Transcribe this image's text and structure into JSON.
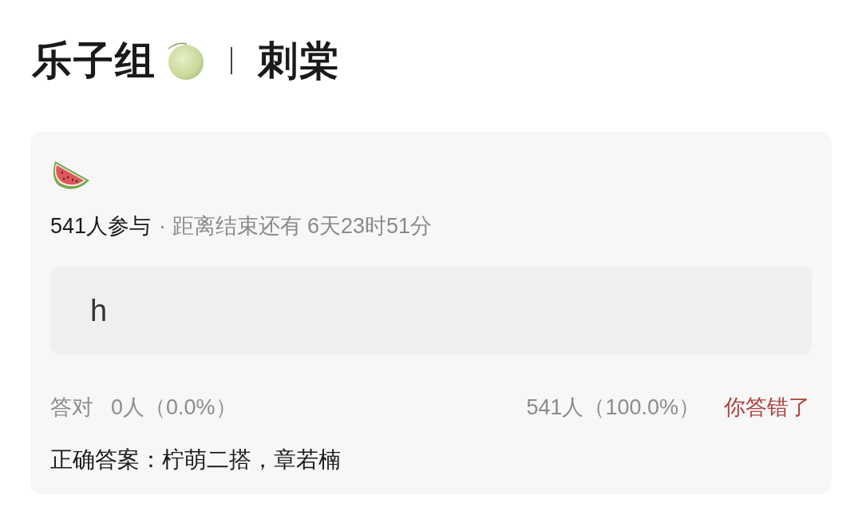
{
  "header": {
    "title": "乐子组",
    "subtitle": "刺棠"
  },
  "card": {
    "participants": "541人参与",
    "deadline": "· 距离结束还有 6天23时51分",
    "options": [
      {
        "text": "h"
      }
    ],
    "stats": {
      "correct_label": "答对",
      "correct_count": "0人（0.0%）",
      "wrong_count": "541人（100.0%）",
      "result": {
        "text": "你答错了",
        "correct": false
      }
    },
    "answer": "正确答案：柠萌二搭，章若楠"
  }
}
